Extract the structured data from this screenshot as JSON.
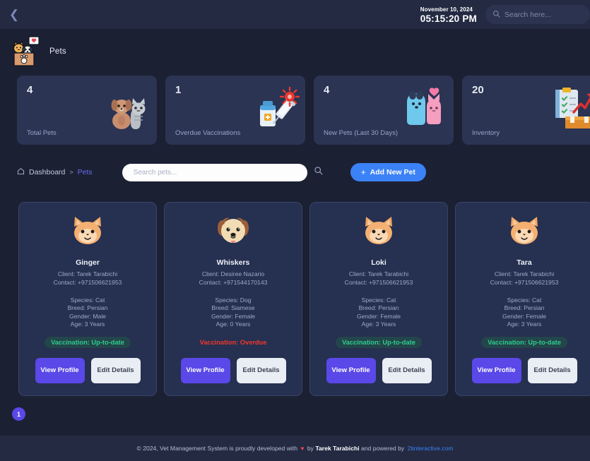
{
  "topbar": {
    "back_icon": "chevron-left-icon",
    "date": "November 10, 2024",
    "time": "05:15:20 PM",
    "search_placeholder": "Search here...",
    "search_icon": "search-icon"
  },
  "page": {
    "title": "Pets",
    "emblem_icon": "pets-in-box-icon"
  },
  "stats": [
    {
      "value": "4",
      "label": "Total Pets",
      "icon": "dog-and-cat-icon"
    },
    {
      "value": "1",
      "label": "Overdue Vaccinations",
      "icon": "syringe-vaccine-icon"
    },
    {
      "value": "4",
      "label": "New Pets (Last 30 Days)",
      "icon": "two-pets-heart-icon"
    },
    {
      "value": "20",
      "label": "Inventory",
      "icon": "clipboard-boxes-chart-icon"
    }
  ],
  "toolbar": {
    "home_icon": "home-icon",
    "breadcrumb_root": "Dashboard",
    "breadcrumb_separator": ">",
    "breadcrumb_current": "Pets",
    "search_placeholder": "Search pets...",
    "search_value": "",
    "search_icon": "search-icon",
    "add_button_label": "Add New Pet",
    "add_button_plus": "+"
  },
  "pets": [
    {
      "avatar_icon": "cat-face-icon",
      "name": "Ginger",
      "client": "Client: Tarek Tarabichi",
      "contact": "Contact: +971506621953",
      "species": "Species: Cat",
      "breed": "Breed: Persian",
      "gender": "Gender: Male",
      "age": "Age: 3 Years",
      "vaccination": "Vaccination: Up-to-date",
      "vaccination_status": "ok",
      "view_label": "View\nProfile",
      "edit_label": "Edit\nDetails"
    },
    {
      "avatar_icon": "dog-face-icon",
      "name": "Whiskers",
      "client": "Client: Desiree Nazario",
      "contact": "Contact: +971544170143",
      "species": "Species: Dog",
      "breed": "Breed: Siamese",
      "gender": "Gender: Female",
      "age": "Age: 0 Years",
      "vaccination": "Vaccination: Overdue",
      "vaccination_status": "overdue",
      "view_label": "View\nProfile",
      "edit_label": "Edit\nDetails"
    },
    {
      "avatar_icon": "cat-face-icon",
      "name": "Loki",
      "client": "Client: Tarek Tarabichi",
      "contact": "Contact: +971506621953",
      "species": "Species: Cat",
      "breed": "Breed: Persian",
      "gender": "Gender: Female",
      "age": "Age: 3 Years",
      "vaccination": "Vaccination: Up-to-date",
      "vaccination_status": "ok",
      "view_label": "View\nProfile",
      "edit_label": "Edit\nDetails"
    },
    {
      "avatar_icon": "cat-face-icon",
      "name": "Tara",
      "client": "Client: Tarek Tarabichi",
      "contact": "Contact: +971506621953",
      "species": "Species: Cat",
      "breed": "Breed: Persian",
      "gender": "Gender: Female",
      "age": "Age: 3 Years",
      "vaccination": "Vaccination: Up-to-date",
      "vaccination_status": "ok",
      "view_label": "View\nProfile",
      "edit_label": "Edit\nDetails"
    }
  ],
  "pagination": {
    "current_page": "1"
  },
  "footer": {
    "text_before": "© 2024, Vet Management System is proudly developed with ",
    "heart": "♥",
    "text_by": " by ",
    "author": "Tarek Tarabichi",
    "text_after": " and powered by ",
    "link": "2tinteractive.com"
  },
  "colors": {
    "page_bg": "#1b2033",
    "bar_bg": "#232a42",
    "card_bg": "#263050",
    "stat_bg": "#2b3452",
    "accent_blue": "#3b82f6",
    "accent_purple": "#5a48e8",
    "status_ok": "#2ecc8f",
    "status_overdue": "#f0382f",
    "breadcrumb_active": "#6b6bf0"
  }
}
